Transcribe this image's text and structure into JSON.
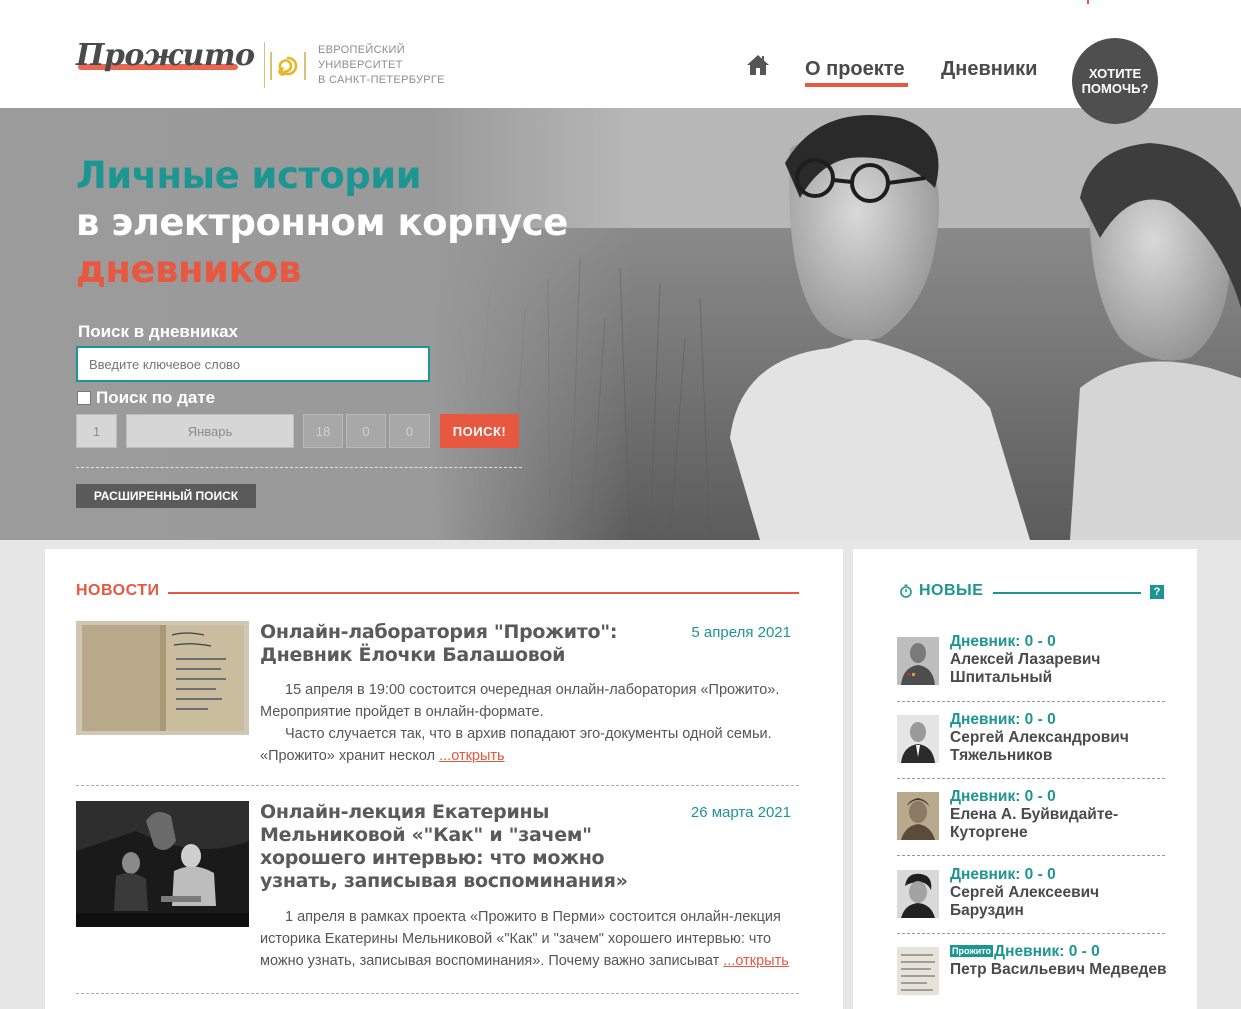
{
  "header": {
    "logo_text": "Прожито",
    "university_text": "ЕВРОПЕЙСКИЙ\nУНИВЕРСИТЕТ\nВ САНКТ-ПЕТЕРБУРГЕ",
    "nav": {
      "home_icon": "home-icon",
      "about_label": "О проекте",
      "diaries_label": "Дневники"
    },
    "help_button_line1": "ХОТИТЕ",
    "help_button_line2": "ПОМОЧЬ?"
  },
  "hero": {
    "title_line1": "Личные истории",
    "title_line2": "в электронном корпусе",
    "title_line3": "дневников",
    "search_label": "Поиск в дневниках",
    "search_placeholder": "Введите ключевое слово",
    "date_search_label": "Поиск по дате",
    "date_search_checked": false,
    "date_fields": {
      "day": "1",
      "month": "Январь",
      "year": "18",
      "hour": "0",
      "minute": "0"
    },
    "search_button": "ПОИСК!",
    "advanced_search_button": "РАСШИРЕННЫЙ ПОИСК"
  },
  "news": {
    "heading": "НОВОСТИ",
    "items": [
      {
        "title": "Онлайн-лаборатория \"Прожито\": Дневник Ёлочки Балашовой",
        "date": "5 апреля 2021",
        "paragraph1": "15 апреля в 19:00 состоится очередная онлайн-лаборатория «Прожито». Мероприятие пройдет в онлайн-формате.",
        "paragraph2": "Часто случается так, что в архив попадают эго-документы одной семьи. «Прожито» хранит нескол",
        "more_link": "...открыть"
      },
      {
        "title": "Онлайн-лекция Екатерины Мельниковой «\"Как\" и \"зачем\" хорошего интервью: что можно узнать, записывая воспоминания»",
        "date": "26 марта 2021",
        "paragraph1": "1 апреля в рамках проекта «Прожито в Перми» состоится онлайн-лекция историка Екатерины Мельниковой «\"Как\" и \"зачем\" хорошего интервью: что можно узнать, записывая воспоминания». Почему важно записыват",
        "more_link": "...открыть"
      }
    ]
  },
  "new_diaries": {
    "heading": "НОВЫЕ",
    "help_icon": "?",
    "items": [
      {
        "label": "Дневник: 0 - 0",
        "name": "Алексей Лазаревич Шпитальный",
        "badge": ""
      },
      {
        "label": "Дневник: 0 - 0",
        "name": "Сергей Александрович Тяжельников",
        "badge": ""
      },
      {
        "label": "Дневник: 0 - 0",
        "name": "Елена А. Буйвидайте-Куторгене",
        "badge": ""
      },
      {
        "label": "Дневник: 0 - 0",
        "name": "Сергей Алексеевич Баруздин",
        "badge": ""
      },
      {
        "label": "Дневник: 0 - 0",
        "name": "Петр Васильевич Медведев",
        "badge": "Прожито"
      }
    ]
  },
  "colors": {
    "accent_red": "#e8573f",
    "accent_teal": "#1d9693",
    "text_dark": "#4a4a4a"
  }
}
